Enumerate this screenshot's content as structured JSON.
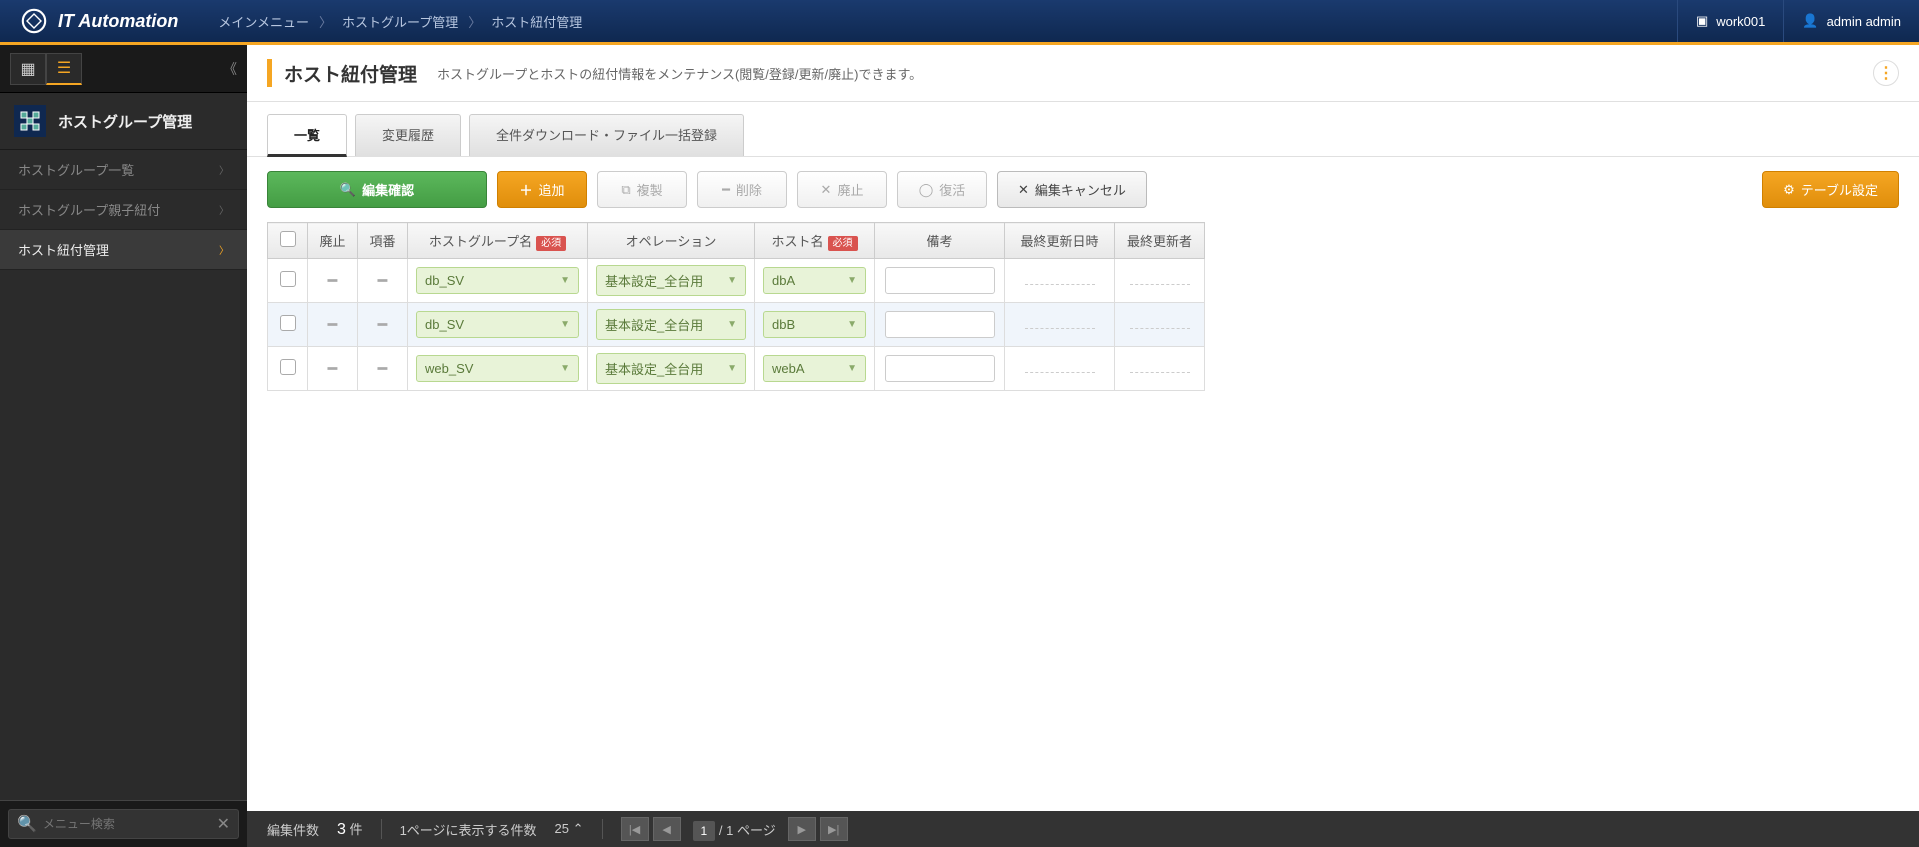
{
  "app_name": "IT Automation",
  "breadcrumb": [
    "メインメニュー",
    "ホストグループ管理",
    "ホスト紐付管理"
  ],
  "workspace": "work001",
  "user": "admin admin",
  "sidebar": {
    "title": "ホストグループ管理",
    "items": [
      {
        "label": "ホストグループ一覧",
        "active": false
      },
      {
        "label": "ホストグループ親子紐付",
        "active": false
      },
      {
        "label": "ホスト紐付管理",
        "active": true
      }
    ],
    "search_placeholder": "メニュー検索"
  },
  "page": {
    "title": "ホスト紐付管理",
    "description": "ホストグループとホストの紐付情報をメンテナンス(閲覧/登録/更新/廃止)できます。"
  },
  "tabs": [
    "一覧",
    "変更履歴",
    "全件ダウンロード・ファイル一括登録"
  ],
  "toolbar": {
    "confirm": "編集確認",
    "add": "追加",
    "copy": "複製",
    "delete": "削除",
    "discard": "廃止",
    "restore": "復活",
    "cancel": "編集キャンセル",
    "table_settings": "テーブル設定"
  },
  "table": {
    "headers": {
      "discard": "廃止",
      "no": "項番",
      "hostgroup": "ホストグループ名",
      "operation": "オペレーション",
      "host": "ホスト名",
      "remark": "備考",
      "updated_at": "最終更新日時",
      "updated_by": "最終更新者",
      "required": "必須"
    },
    "rows": [
      {
        "hostgroup": "db_SV",
        "operation": "基本設定_全台用",
        "host": "dbA",
        "remark": ""
      },
      {
        "hostgroup": "db_SV",
        "operation": "基本設定_全台用",
        "host": "dbB",
        "remark": ""
      },
      {
        "hostgroup": "web_SV",
        "operation": "基本設定_全台用",
        "host": "webA",
        "remark": ""
      }
    ]
  },
  "footer": {
    "edit_label": "編集件数",
    "count": "3",
    "unit": "件",
    "per_page_label": "1ページに表示する件数",
    "per_page": "25",
    "page_current": "1",
    "page_sep": "/",
    "page_total": "1 ページ"
  }
}
